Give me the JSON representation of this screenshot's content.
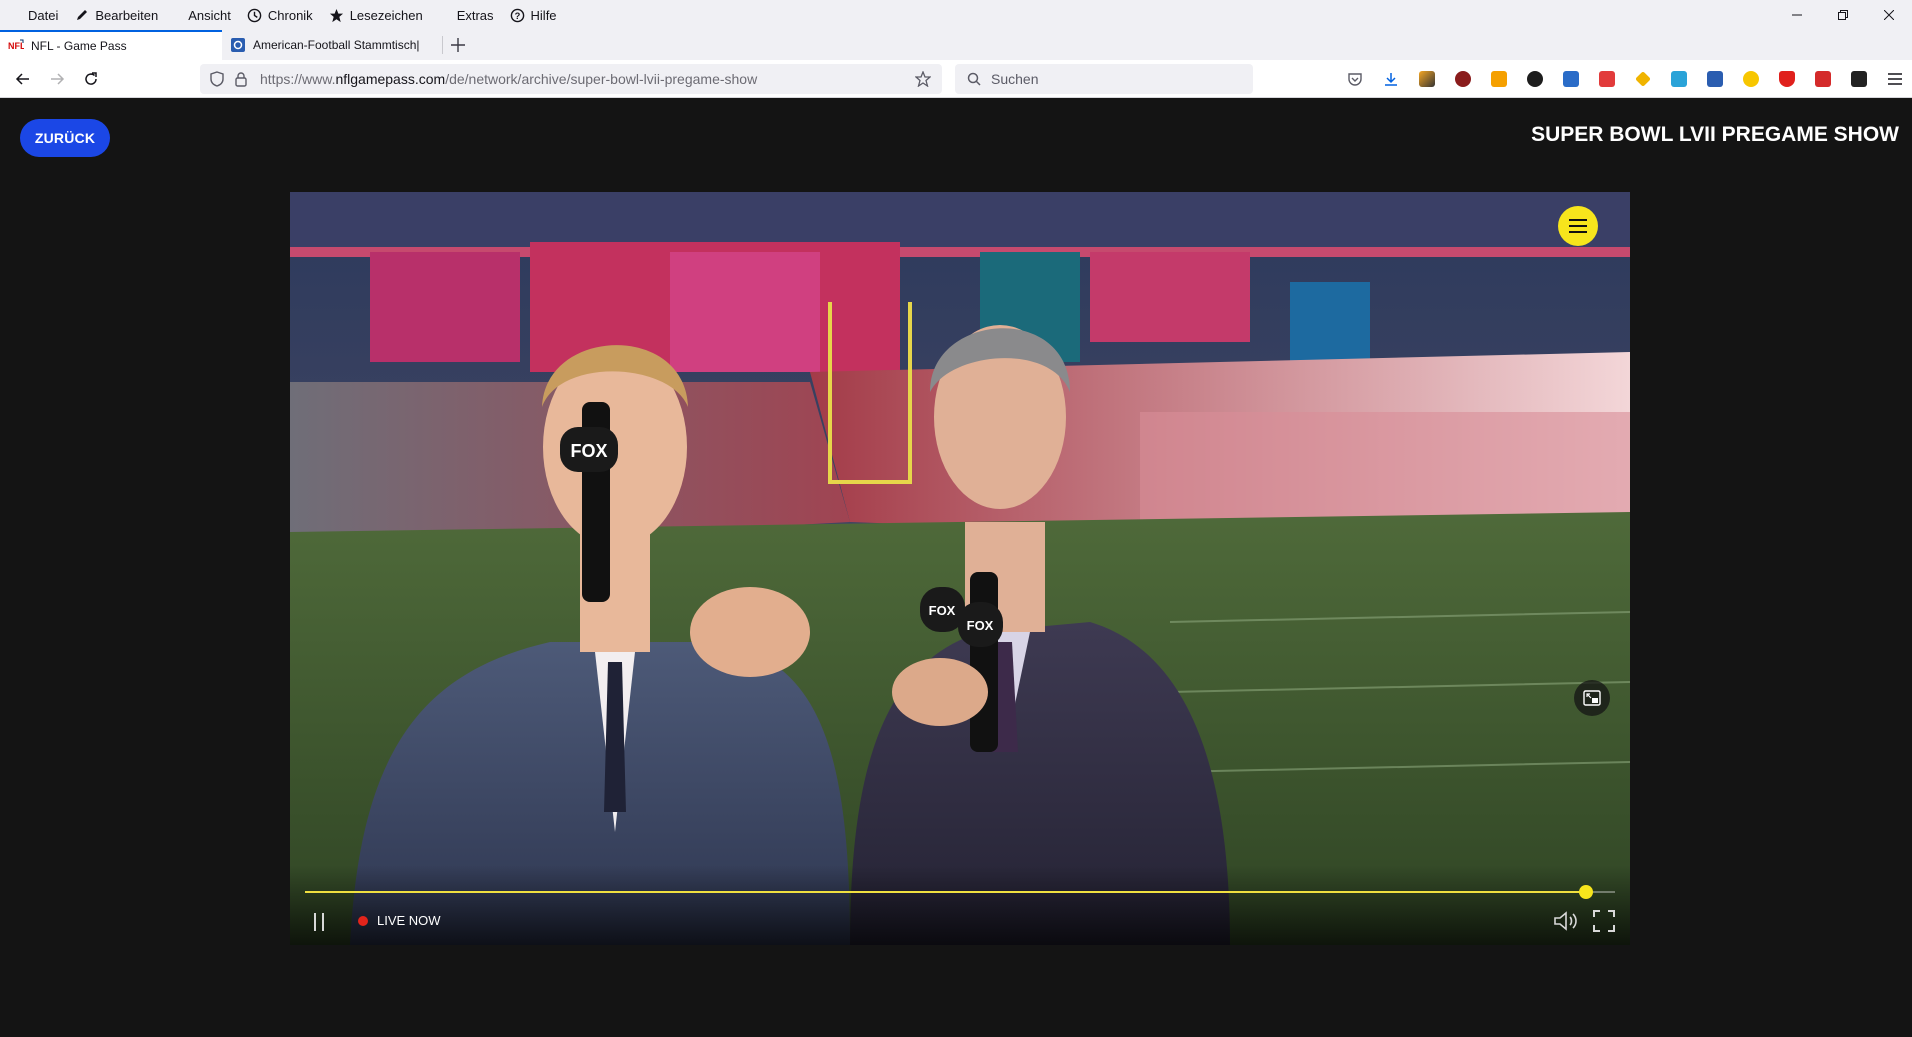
{
  "menubar": {
    "items": [
      "Datei",
      "Bearbeiten",
      "Ansicht",
      "Chronik",
      "Lesezeichen",
      "Extras",
      "Hilfe"
    ]
  },
  "tabs": [
    {
      "label": "NFL - Game Pass",
      "icon": "nfl-favicon",
      "active": true
    },
    {
      "label": "American-Football Stammtisch|",
      "icon": "forum-favicon",
      "active": false
    }
  ],
  "urlbar": {
    "prefix": "https://www.",
    "host": "nflgamepass.com",
    "path": "/de/network/archive/super-bowl-lvii-pregame-show"
  },
  "search": {
    "placeholder": "Suchen"
  },
  "page": {
    "back_label": "ZURÜCK",
    "title": "SUPER BOWL LVII PREGAME SHOW"
  },
  "player": {
    "live_label": "LIVE NOW",
    "progress": 0.978,
    "accent": "#f7e51c",
    "live_color": "#e3241b"
  },
  "colors": {
    "back_button": "#1b47e6",
    "page_bg": "#141414"
  }
}
